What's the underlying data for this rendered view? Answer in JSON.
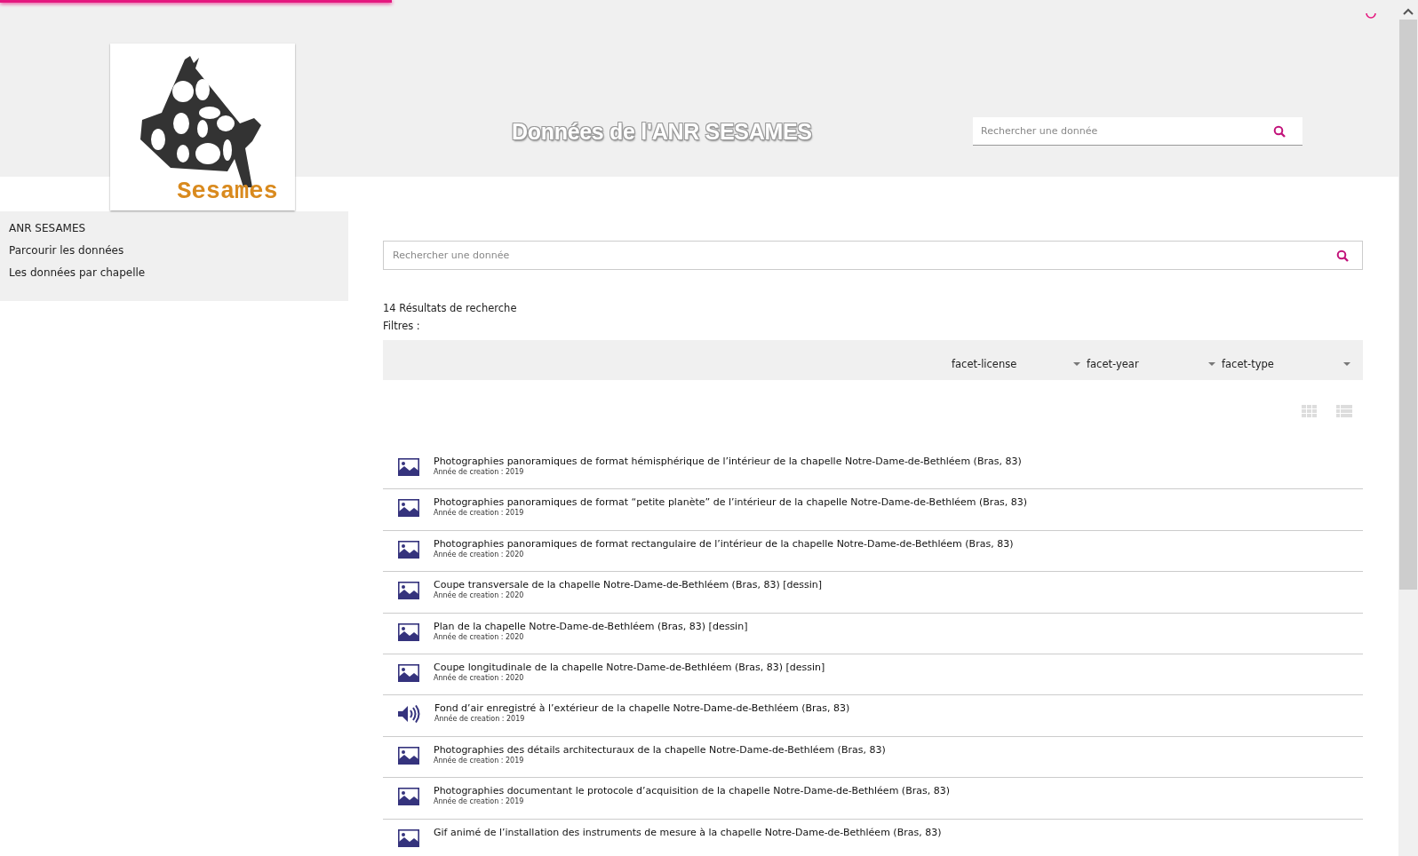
{
  "header": {
    "loading": {
      "level": 0.28
    },
    "logo_text": "Sesames",
    "title": "Données de l'ANR SESAMES",
    "search": {
      "placeholder": "Rechercher une donnée"
    }
  },
  "sidebar": {
    "items": [
      {
        "label": "ANR SESAMES"
      },
      {
        "label": "Parcourir les données"
      },
      {
        "label": "Les données par chapelle"
      }
    ]
  },
  "main": {
    "search": {
      "placeholder": "Rechercher une donnée"
    },
    "results_count": "14 Résultats de recherche",
    "filters_label": "Filtres :",
    "facets": [
      {
        "label": "facet-license"
      },
      {
        "label": "facet-year"
      },
      {
        "label": "facet-type"
      }
    ],
    "results": [
      {
        "kind": "image",
        "title": "Photographies panoramiques de format hémisphérique de l’intérieur de la chapelle Notre-Dame-de-Bethléem (Bras, 83)",
        "year": "Année de creation : 2019"
      },
      {
        "kind": "image",
        "title": "Photographies panoramiques de format “petite planète” de l’intérieur de la chapelle Notre-Dame-de-Bethléem (Bras, 83)",
        "year": "Année de creation : 2019"
      },
      {
        "kind": "image",
        "title": "Photographies panoramiques de format rectangulaire de l’intérieur de la chapelle Notre-Dame-de-Bethléem (Bras, 83)",
        "year": "Année de creation : 2020"
      },
      {
        "kind": "image",
        "title": "Coupe transversale de la chapelle Notre-Dame-de-Bethléem (Bras, 83) [dessin]",
        "year": "Année de creation : 2020"
      },
      {
        "kind": "image",
        "title": "Plan de la chapelle Notre-Dame-de-Bethléem (Bras, 83) [dessin]",
        "year": "Année de creation : 2020"
      },
      {
        "kind": "image",
        "title": "Coupe longitudinale de la chapelle Notre-Dame-de-Bethléem (Bras, 83) [dessin]",
        "year": "Année de creation : 2020"
      },
      {
        "kind": "audio",
        "title": "Fond d’air enregistré à l’extérieur de la chapelle Notre-Dame-de-Bethléem (Bras, 83)",
        "year": "Année de creation : 2019"
      },
      {
        "kind": "image",
        "title": "Photographies des détails architecturaux de la chapelle Notre-Dame-de-Bethléem (Bras, 83)",
        "year": "Année de creation : 2019"
      },
      {
        "kind": "image",
        "title": "Photographies documentant le protocole d’acquisition de la chapelle Notre-Dame-de-Bethléem (Bras, 83)",
        "year": "Année de creation : 2019"
      },
      {
        "kind": "image",
        "title": "Gif animé de l’installation des instruments de mesure à la chapelle Notre-Dame-de-Bethléem (Bras, 83)"
      }
    ]
  }
}
